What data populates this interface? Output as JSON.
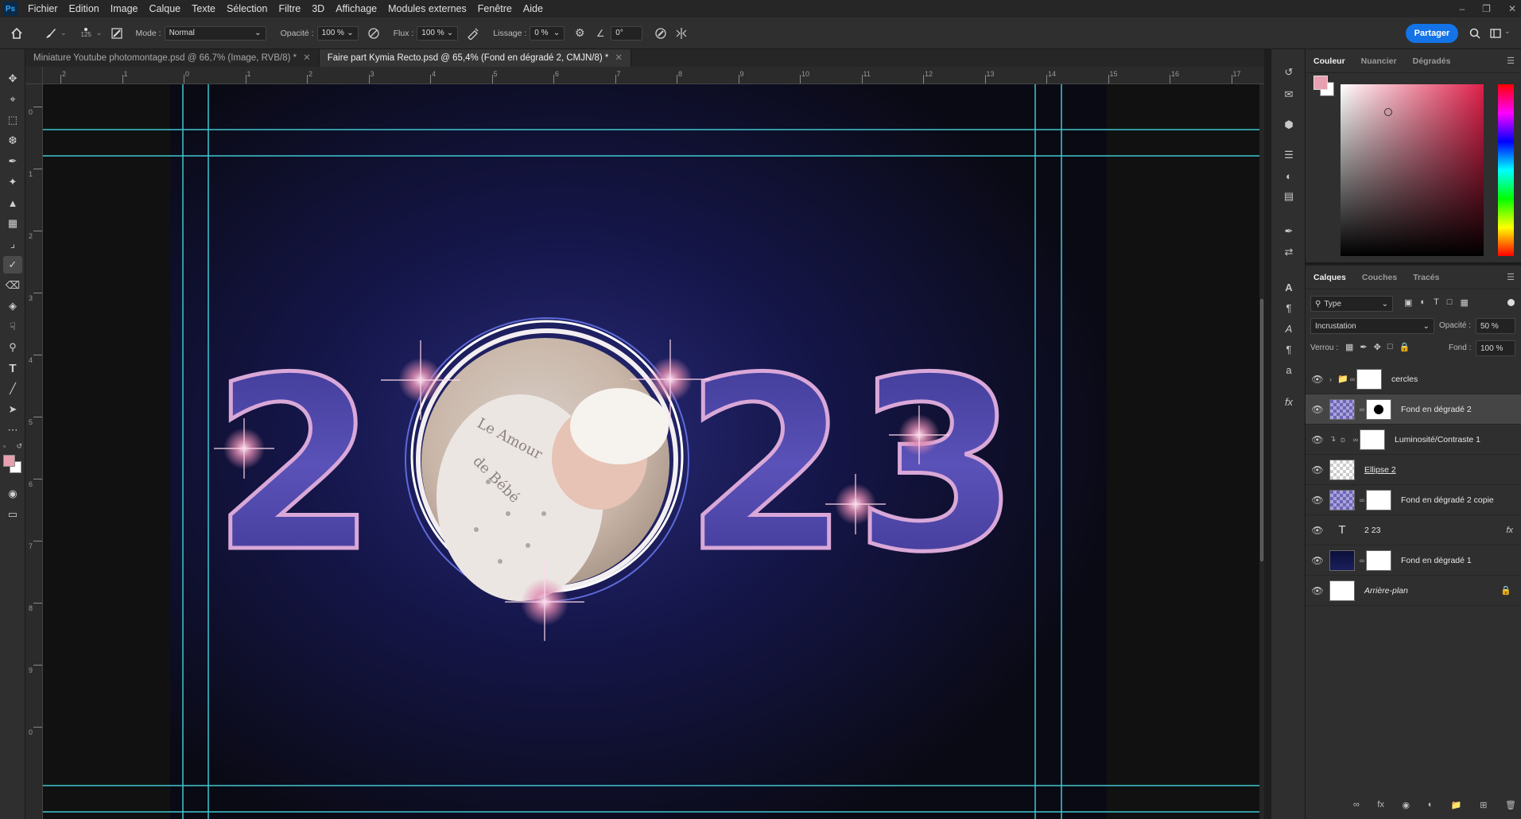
{
  "menubar": {
    "logo": "Ps",
    "items": [
      "Fichier",
      "Edition",
      "Image",
      "Calque",
      "Texte",
      "Sélection",
      "Filtre",
      "3D",
      "Affichage",
      "Modules externes",
      "Fenêtre",
      "Aide"
    ]
  },
  "options": {
    "brush_size": "125",
    "mode_label": "Mode :",
    "mode_value": "Normal",
    "opacity_label": "Opacité :",
    "opacity_value": "100 %",
    "flow_label": "Flux :",
    "flow_value": "100 %",
    "smoothing_label": "Lissage :",
    "smoothing_value": "0 %",
    "angle_value": "0°",
    "share_label": "Partager"
  },
  "tabs": [
    {
      "label": "Miniature Youtube photomontage.psd @ 66,7% (Image, RVB/8) *"
    },
    {
      "label": "Faire part Kymia Recto.psd @ 65,4% (Fond en dégradé 2, CMJN/8) *"
    }
  ],
  "rulers": {
    "h": [
      "2",
      "1",
      "0",
      "1",
      "2",
      "3",
      "4",
      "5",
      "6",
      "7",
      "8",
      "9",
      "10",
      "11",
      "12",
      "13",
      "14",
      "15",
      "16",
      "17"
    ],
    "v": [
      "0",
      "1",
      "2",
      "3",
      "4",
      "5",
      "6",
      "7",
      "8",
      "9",
      "0"
    ]
  },
  "artwork": {
    "digits": [
      "2",
      "2",
      "3"
    ],
    "photo_text_line1": "Le Amour",
    "photo_text_line2": "de Bébé"
  },
  "color_panel": {
    "tabs": [
      "Couleur",
      "Nuancier",
      "Dégradés"
    ],
    "foreground": "#e8a0b0",
    "background": "#ffffff",
    "hue": "#e0204a"
  },
  "layers_panel": {
    "tabs": [
      "Calques",
      "Couches",
      "Tracés"
    ],
    "filter_value": "Type",
    "blend_mode": "Incrustation",
    "opacity_label": "Opacité :",
    "opacity_value": "50 %",
    "lock_label": "Verrou :",
    "fill_label": "Fond :",
    "fill_value": "100 %",
    "layers": [
      {
        "name": "cercles",
        "kind": "group"
      },
      {
        "name": "Fond en dégradé 2",
        "kind": "fill-mask"
      },
      {
        "name": "Luminosité/Contraste 1",
        "kind": "adjust"
      },
      {
        "name": "Ellipse 2",
        "kind": "shape"
      },
      {
        "name": "Fond en dégradé 2 copie",
        "kind": "fill"
      },
      {
        "name": "2   23",
        "kind": "text"
      },
      {
        "name": "Fond en dégradé 1",
        "kind": "fill-dark"
      },
      {
        "name": "Arrière-plan",
        "kind": "background"
      }
    ]
  },
  "colors": {
    "accent": "#1473e6",
    "guide": "#3fc7d0",
    "digit_fill": "#4a3f9c",
    "digit_outline": "#d9a8d8"
  }
}
